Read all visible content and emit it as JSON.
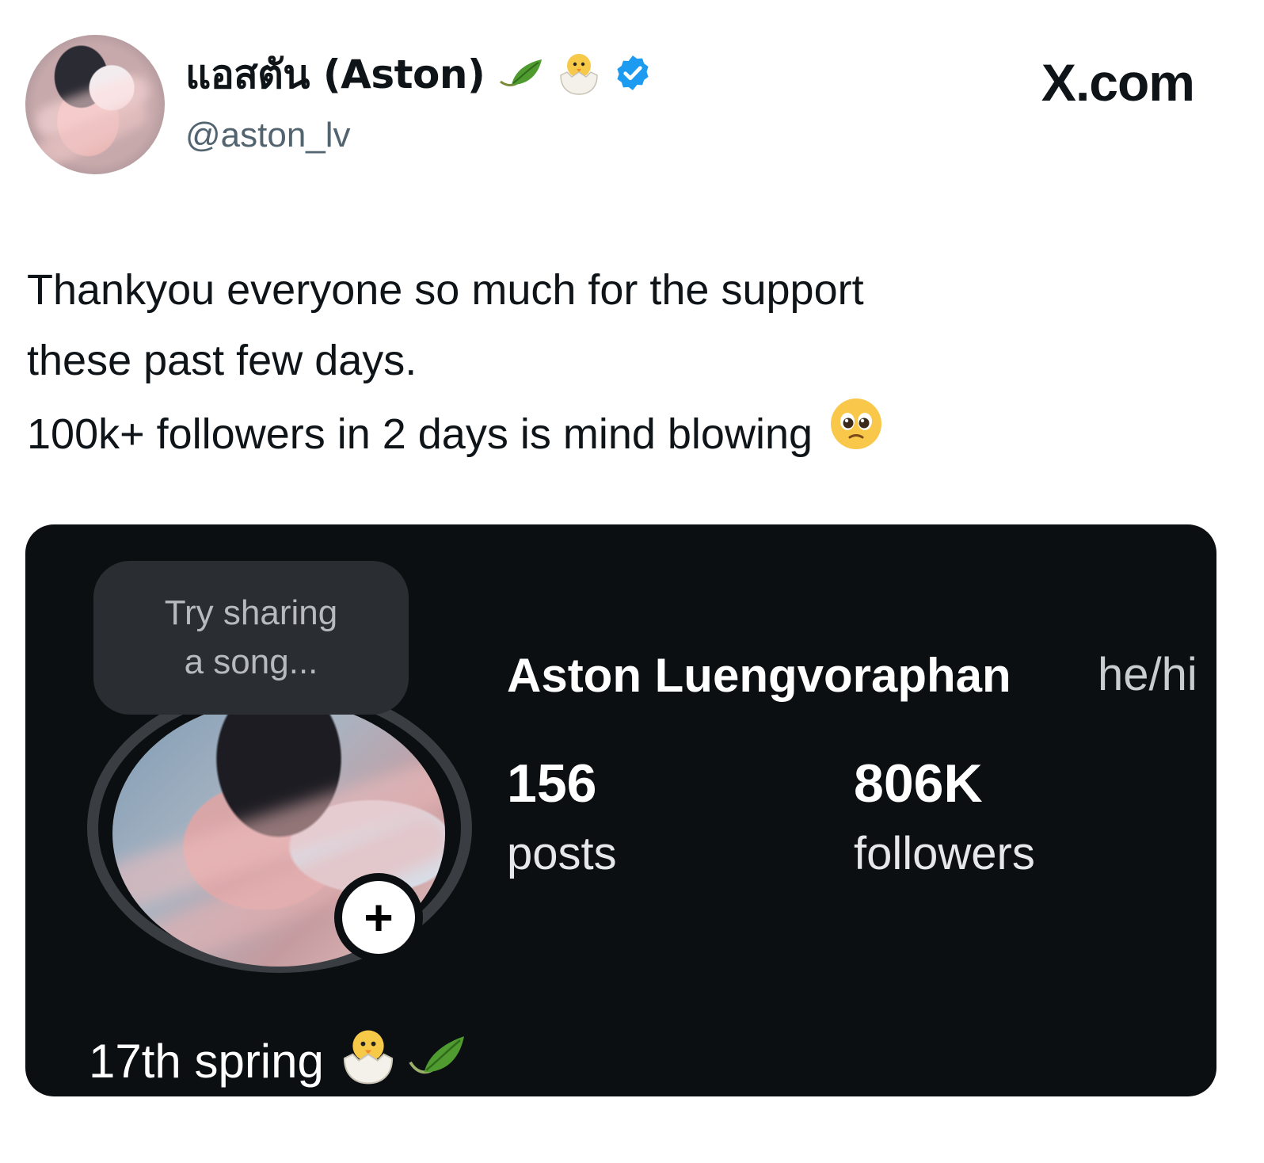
{
  "tweet": {
    "display_name": "แอสตัน (Aston)",
    "handle": "@aston_lv",
    "source": "X.com",
    "text_lines": [
      "Thankyou everyone so much for the support",
      "these past few days.",
      "100k+ followers in 2 days is mind blowing"
    ]
  },
  "profile_card": {
    "note_lines": [
      "Try sharing",
      "a song..."
    ],
    "add_story_symbol": "+",
    "full_name": "Aston Luengvoraphan",
    "pronouns": "he/hi",
    "stats": [
      {
        "value": "156",
        "label": "posts"
      },
      {
        "value": "806K",
        "label": "followers"
      }
    ],
    "bio": "17th spring"
  },
  "icons": [
    "leaf-icon",
    "hatching-chick-icon",
    "verified-badge-icon",
    "pleading-face-icon"
  ],
  "colors": {
    "verified": "#1d9bf0",
    "card_bg": "#0b0f12",
    "handle": "#536471"
  }
}
